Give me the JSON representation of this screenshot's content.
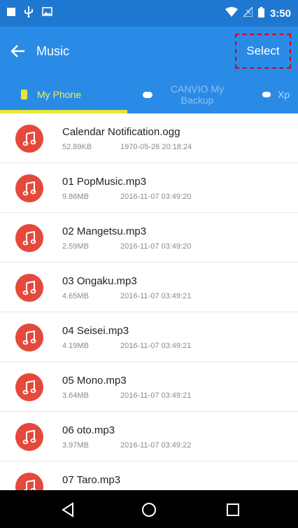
{
  "status_bar": {
    "time": "3:50",
    "left_icons": [
      "notification-square-icon",
      "usb-icon",
      "image-icon"
    ],
    "right_icons": [
      "wifi-icon",
      "no-signal-icon",
      "battery-icon"
    ]
  },
  "app_bar": {
    "title": "Music",
    "select_label": "Select",
    "color": "#2a8be6"
  },
  "tabs": [
    {
      "label": "My Phone",
      "icon": "phone-icon",
      "selected": true
    },
    {
      "label": "CANVIO My Backup",
      "icon": "drive-icon",
      "selected": false
    },
    {
      "label": "Xp",
      "icon": "drive-icon",
      "selected": false
    }
  ],
  "files": [
    {
      "name": "Calendar Notification.ogg",
      "size": "52.89KB",
      "date": "1970-05-26 20:18:24"
    },
    {
      "name": "01 PopMusic.mp3",
      "size": "9.86MB",
      "date": "2016-11-07 03:49:20"
    },
    {
      "name": "02 Mangetsu.mp3",
      "size": "2.59MB",
      "date": "2016-11-07 03:49:20"
    },
    {
      "name": "03 Ongaku.mp3",
      "size": "4.65MB",
      "date": "2016-11-07 03:49:21"
    },
    {
      "name": "04 Seisei.mp3",
      "size": "4.19MB",
      "date": "2016-11-07 03:49:21"
    },
    {
      "name": "05 Mono.mp3",
      "size": "3.64MB",
      "date": "2016-11-07 03:49:21"
    },
    {
      "name": "06 oto.mp3",
      "size": "3.97MB",
      "date": "2016-11-07 03:49:22"
    },
    {
      "name": "07 Taro.mp3",
      "size": "",
      "date": ""
    }
  ],
  "nav": {
    "buttons": [
      "back-triangle-icon",
      "home-circle-icon",
      "recents-square-icon"
    ]
  },
  "colors": {
    "accent": "#2a8be6",
    "status_bar": "#1f78cf",
    "music_icon": "#e5493b",
    "tab_indicator": "#e6e63a",
    "highlight_box": "#d0021b"
  }
}
